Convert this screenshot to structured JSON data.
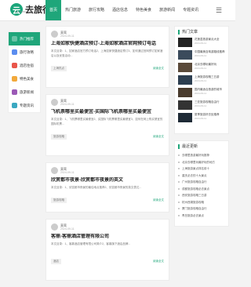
{
  "logo": {
    "mark": "云",
    "name": "去旅行",
    "tagline": "QULVXING.COM"
  },
  "nav": {
    "items": [
      {
        "label": "首页",
        "active": true
      },
      {
        "label": "热门旅游"
      },
      {
        "label": "旅行攻略"
      },
      {
        "label": "酒店信息"
      },
      {
        "label": "特色美食"
      },
      {
        "label": "旅游新闻"
      },
      {
        "label": "专题资讯"
      }
    ],
    "menu_icon": "menu-icon"
  },
  "sidebar": {
    "items": [
      {
        "label": "热门推荐",
        "color": "#1fa67a",
        "active": true
      },
      {
        "label": "旅行攻略",
        "color": "#5b8def"
      },
      {
        "label": "酒店住宿",
        "color": "#e9554a"
      },
      {
        "label": "特色美食",
        "color": "#f2a93b"
      },
      {
        "label": "旅游新闻",
        "color": "#9b59b6"
      },
      {
        "label": "专题资讯",
        "color": "#3aa8c1"
      }
    ]
  },
  "posts": [
    {
      "author": "莫莺",
      "date": "2024-09-11",
      "title": "上海如家快捷酒店预订-上海如家酒店官网预订电话",
      "text": "本文目录：1、如家酒店官方预订电话2、上海如家快捷酒店预订3、如何通过官网预订如家酒店以及优惠活动...",
      "tag": "上海热点",
      "more": "阅读全文"
    },
    {
      "author": "莫莺",
      "date": "2024-09-11",
      "title": "飞机票哪里买最便宜-买国际飞机票哪里买最便宜",
      "text": "本文目录：1、飞机票哪里买最便宜2、买国际飞机票哪里买最便宜3、如何在网上购买便宜的国际机票...",
      "tag": "旅游攻略",
      "more": "阅读全文"
    },
    {
      "author": "莫莺",
      "date": "2024-09-11",
      "title": "欣赏都市夜景-欣赏都市夜景的英文",
      "text": "本文目录：1、欣赏都市夜景的最佳地点推荐2、欣赏都市夜景的英文表达...",
      "tag": "旅游攻略",
      "more": "阅读全文"
    },
    {
      "author": "莫莺",
      "date": "2024-09-11",
      "title": "客鼎-客鼎酒店管理有限公司",
      "text": "本文目录：1、客鼎酒店管理有限公司简介2、客鼎旗下酒店品牌...",
      "tag": "酒店",
      "more": "阅读全文"
    }
  ],
  "right": {
    "hot_title": "热门文章",
    "hot": [
      {
        "title": "花莲县旅游景点大全",
        "date": "2024-09-11"
      },
      {
        "title": "中国最美自驾游路线推荐",
        "date": "2024-09-11"
      },
      {
        "title": "北京去哪玩最好玩",
        "date": "2024-09-11"
      },
      {
        "title": "上海旅游攻略三日游",
        "date": "2024-09-11"
      },
      {
        "title": "国内最适合旅游的城市",
        "date": "2024-09-11"
      },
      {
        "title": "三亚旅游攻略自由行",
        "date": "2024-09-11"
      },
      {
        "title": "夏季旅游好去处推荐",
        "date": "2024-09-11"
      }
    ],
    "updates_title": "最近更新",
    "updates": [
      "去哪里旅游最好玩推荐",
      "北京去哪里玩最好玩的地方",
      "上海旅游景点排名前十",
      "重庆必去的十大景点",
      "广州旅游攻略自由行",
      "成都旅游攻略必去景点",
      "西安旅游攻略三日游",
      "杭州西湖旅游攻略",
      "厦门旅游攻略自由行",
      "青岛旅游必去景点"
    ]
  }
}
